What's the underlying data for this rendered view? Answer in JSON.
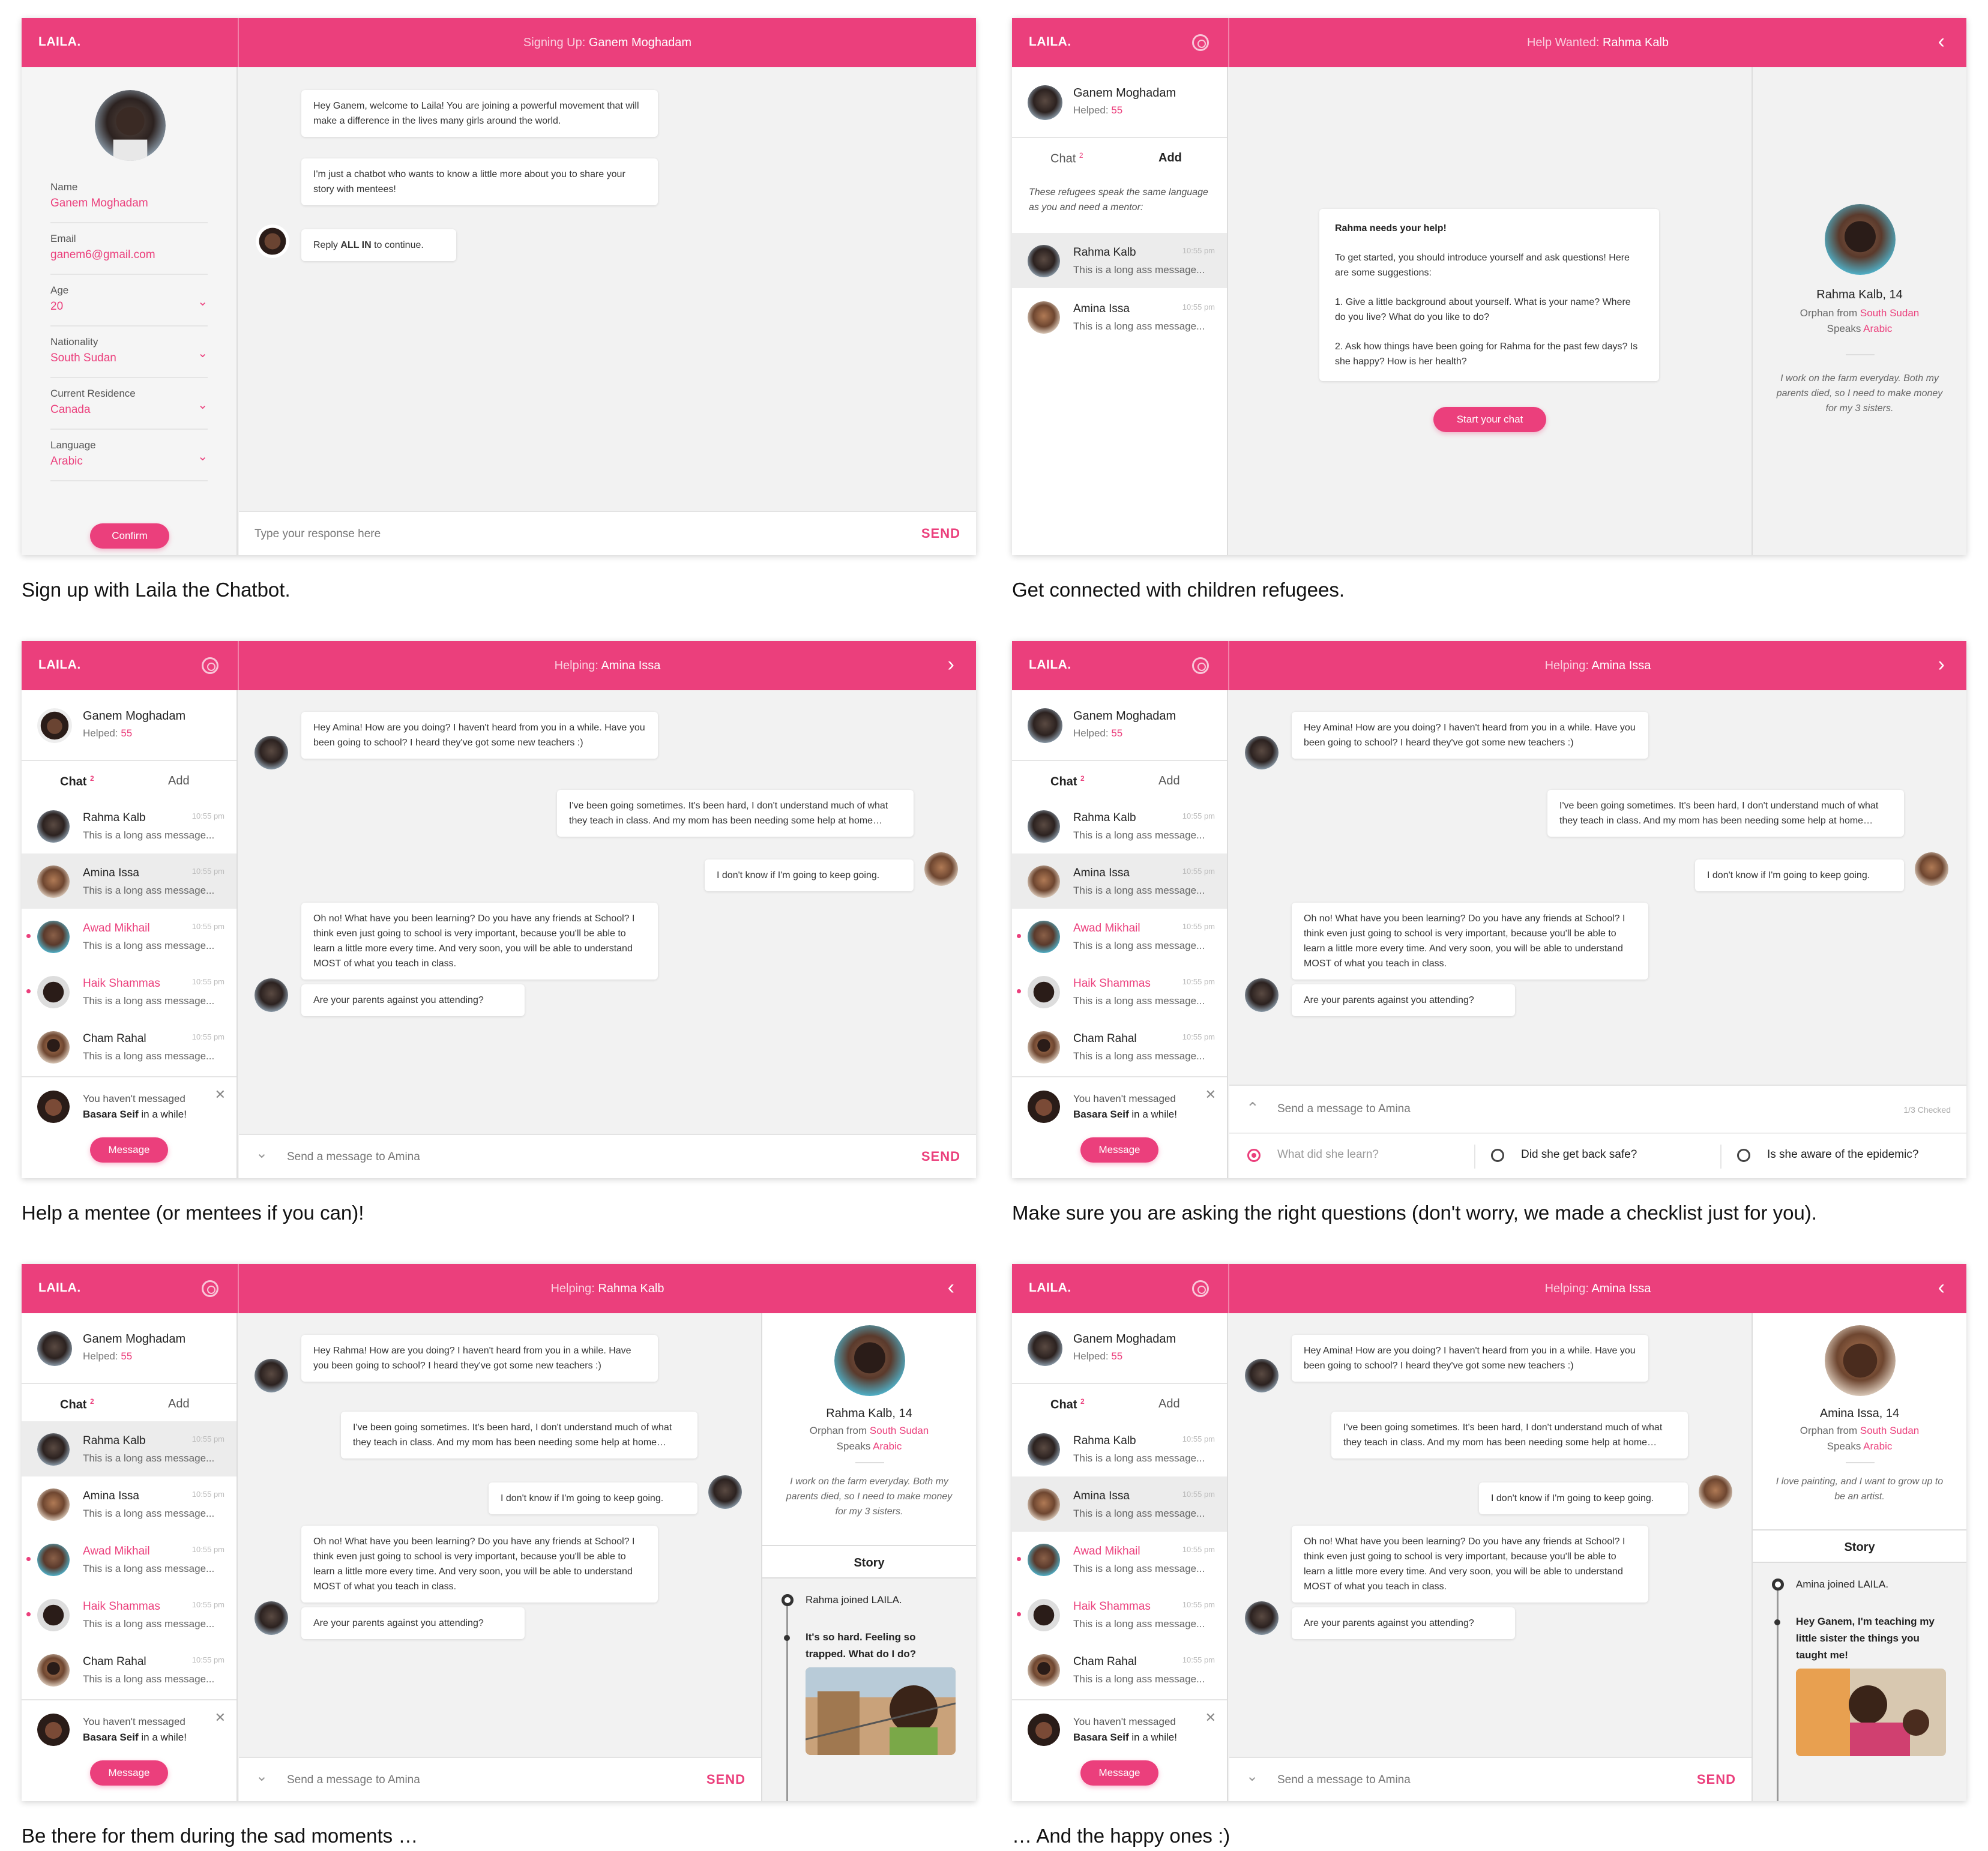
{
  "brand": "LAILA.",
  "colors": {
    "accent": "#eb3f7c"
  },
  "me": {
    "name": "Ganem Moghadam",
    "helped_label": "Helped:",
    "helped_count": "55"
  },
  "tabs": {
    "chat": "Chat",
    "chat_count": "2",
    "add": "Add"
  },
  "send_label": "SEND",
  "time": "10:55 pm",
  "preview": "This is a long ass message...",
  "convs": [
    {
      "name": "Rahma Kalb"
    },
    {
      "name": "Amina Issa"
    },
    {
      "name": "Awad Mikhail"
    },
    {
      "name": "Haik Shammas"
    },
    {
      "name": "Cham Rahal"
    }
  ],
  "reminder": {
    "line1": "You haven't messaged",
    "name": "Basara Seif",
    "line2": "in a while!",
    "button": "Message"
  },
  "chat": {
    "m1_amina": "Hey Amina! How are you doing? I haven't heard from you in a while. Have you been going to school? I heard they've got some new teachers :)",
    "m1_rahma": "Hey Rahma! How are you doing? I haven't heard from you in a while. Have you been going to school? I heard they've got some new teachers :)",
    "m2": "I've been going sometimes. It's been hard, I don't understand much of what they teach in class. And my mom has been needing some help at home…",
    "m3": "I don't know if I'm going to keep going.",
    "m4": "Oh no! What have you been learning? Do you have any friends at School? I think even just going to school is very important, because you'll be able to learn a little more every time. And very soon, you will be able to understand MOST of what you teach in class.",
    "m5": "Are your parents against you attending?",
    "placeholder": "Send a message to Amina"
  },
  "panels": [
    {
      "title_prefix": "Signing Up:",
      "title_name": "Ganem Moghadam",
      "caption": "Sign up with Laila the Chatbot.",
      "fields": [
        {
          "label": "Name",
          "value": "Ganem Moghadam"
        },
        {
          "label": "Email",
          "value": "ganem6@gmail.com"
        },
        {
          "label": "Age",
          "value": "20"
        },
        {
          "label": "Nationality",
          "value": "South Sudan"
        },
        {
          "label": "Current Residence",
          "value": "Canada"
        },
        {
          "label": "Language",
          "value": "Arabic"
        }
      ],
      "confirm": "Confirm",
      "bot1": "Hey Ganem, welcome to Laila! You are joining a powerful movement that will make a difference in the lives many girls around the world.",
      "bot2": "I'm just a chatbot who wants to know a little more about you to share your story with mentees!",
      "bot3_pre": "Reply",
      "bot3_bold": "ALL IN",
      "bot3_post": "to continue.",
      "placeholder": "Type your response here"
    },
    {
      "title_prefix": "Help Wanted:",
      "title_name": "Rahma Kalb",
      "caption": "Get connected with children refugees.",
      "intro": "These refugees speak the same language as you and need a mentor:",
      "card_title": "Rahma needs your help!",
      "card_p1": "To get started, you should introduce yourself and ask questions! Here are some suggestions:",
      "card_p2": "1. Give a little background about yourself. What is your name? Where do you live? What do you like to do?",
      "card_p3": "2. Ask how things have been going for Rahma for the past few days? Is she happy? How is her health?",
      "start": "Start your chat"
    },
    {
      "title_prefix": "Helping:",
      "title_name": "Amina Issa",
      "caption": "Help a mentee (or mentees if you can)!"
    },
    {
      "title_prefix": "Helping:",
      "title_name": "Amina Issa",
      "caption": "Make sure you are asking the right questions (don't worry, we made a checklist just for you).",
      "checked": "1/3 Checked",
      "checks": [
        "What did she learn?",
        "Did she get back safe?",
        "Is she aware of the epidemic?"
      ]
    },
    {
      "title_prefix": "Helping:",
      "title_name": "Rahma Kalb",
      "caption": "Be there for them during the sad moments …"
    },
    {
      "title_prefix": "Helping:",
      "title_name": "Amina Issa",
      "caption": "… And the happy ones :)"
    }
  ],
  "profiles": {
    "rahma": {
      "name": "Rahma Kalb, 14",
      "orphan": "Orphan from",
      "country": "South Sudan",
      "speaks": "Speaks",
      "lang": "Arabic",
      "quote": "I work on the farm everyday. Both my parents died, so I need to make money for my 3 sisters.",
      "story_title": "Story",
      "ev1": "Rahma joined LAILA.",
      "ev2": "It's so hard. Feeling so trapped. What do I do?"
    },
    "amina": {
      "name": "Amina Issa, 14",
      "orphan": "Orphan from",
      "country": "South Sudan",
      "speaks": "Speaks",
      "lang": "Arabic",
      "quote": "I love painting, and I want to grow up to be an artist.",
      "story_title": "Story",
      "ev1": "Amina joined LAILA.",
      "ev2": "Hey Ganem, I'm teaching my little sister the things you taught me!"
    }
  }
}
